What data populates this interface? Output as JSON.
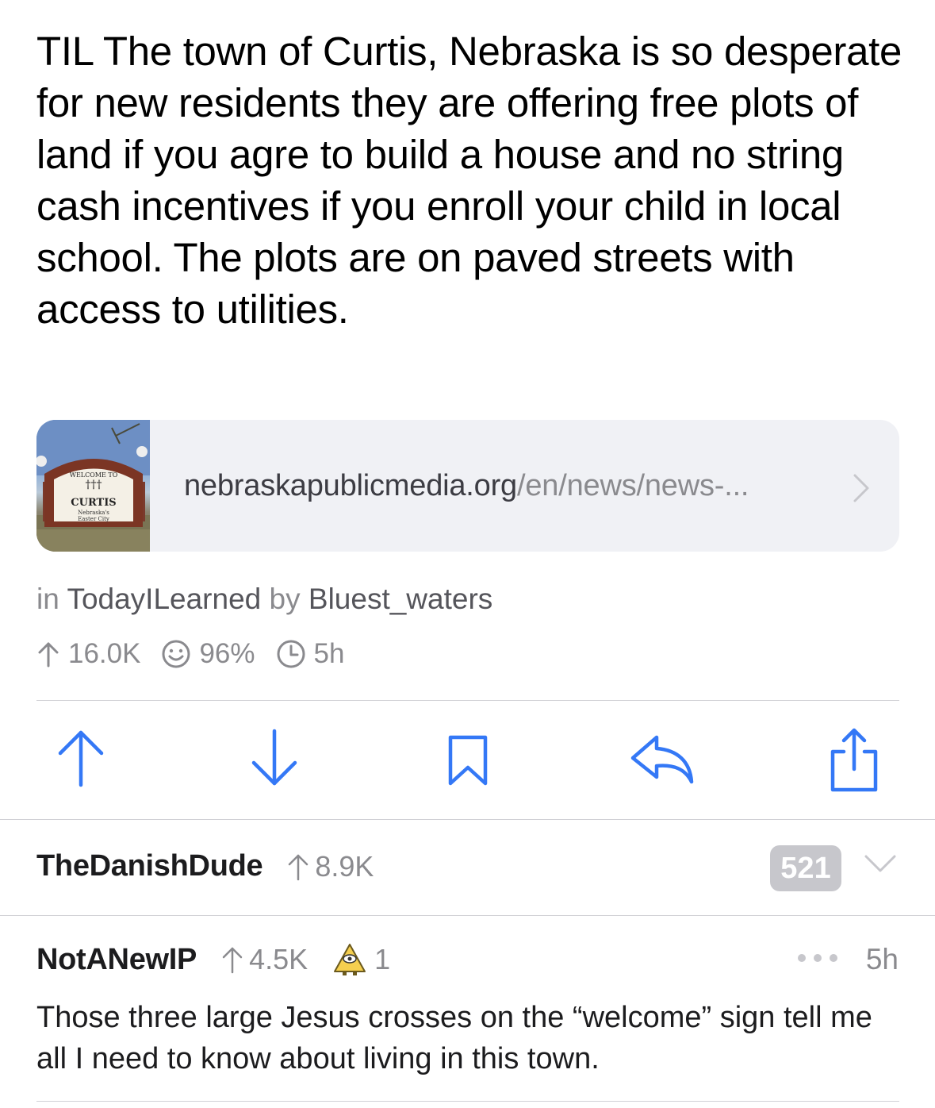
{
  "post": {
    "title": "TIL The town of Curtis, Nebraska is so desperate for new residents they are offering free plots of land if you agre to build a house and no string cash incentives if you enroll your child in local school. The plots are on paved streets with access to utilities.",
    "link": {
      "domain": "nebraskapublicmedia.org",
      "path": "/en/news/news-...",
      "thumbnail": {
        "sign_top": "WELCOME TO",
        "sign_name": "CURTIS",
        "sign_sub1": "Nebraska's",
        "sign_sub2": "Easter City"
      }
    },
    "meta": {
      "in_label": "in",
      "subreddit": "TodayILearned",
      "by_label": "by",
      "author": "Bluest_waters"
    },
    "stats": {
      "upvotes": "16.0K",
      "ratio": "96%",
      "age": "5h",
      "icons": [
        "arrow-up-icon",
        "smiley-icon",
        "clock-icon"
      ]
    }
  },
  "actions": [
    {
      "name": "upvote",
      "icon": "arrow-up-icon"
    },
    {
      "name": "downvote",
      "icon": "arrow-down-icon"
    },
    {
      "name": "save",
      "icon": "bookmark-icon"
    },
    {
      "name": "reply",
      "icon": "reply-icon"
    },
    {
      "name": "share",
      "icon": "share-icon"
    }
  ],
  "colors": {
    "accent": "#3478f6",
    "secondary_text": "#8a8a8e",
    "divider": "#d1d1d6",
    "badge_bg": "#c7c7cc"
  },
  "comments": [
    {
      "author": "TheDanishDude",
      "score": "8.9K",
      "collapsed_count": "521",
      "collapsed": true
    },
    {
      "author": "NotANewIP",
      "score": "4.5K",
      "award_count": "1",
      "age": "5h",
      "body": "Those three large Jesus crosses on the “welcome” sign tell me all I need to know about living in this town."
    }
  ]
}
